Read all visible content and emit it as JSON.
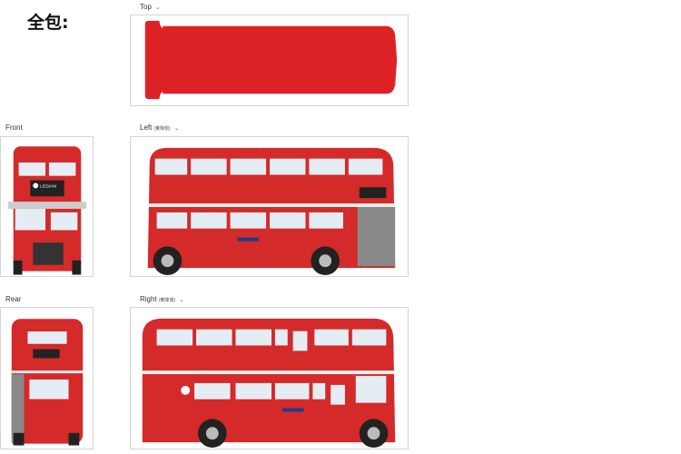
{
  "heading": "全包:",
  "views": {
    "top": {
      "label": "Top",
      "chevron": "⌄"
    },
    "front": {
      "label": "Front"
    },
    "left": {
      "label": "Left",
      "sublabel": "(乗降側)",
      "chevron": "⌄"
    },
    "rear": {
      "label": "Rear"
    },
    "right": {
      "label": "Right",
      "sublabel": "(乗降側)",
      "chevron": "⌄"
    }
  },
  "bus": {
    "body_color": "#d42a2a",
    "dark_red": "#a81e1e",
    "window_color": "#e4ecf4",
    "sign_text": "LEGIAN",
    "roundel_color": "#d42a2a",
    "roof_panel_color": "#dd2226"
  }
}
